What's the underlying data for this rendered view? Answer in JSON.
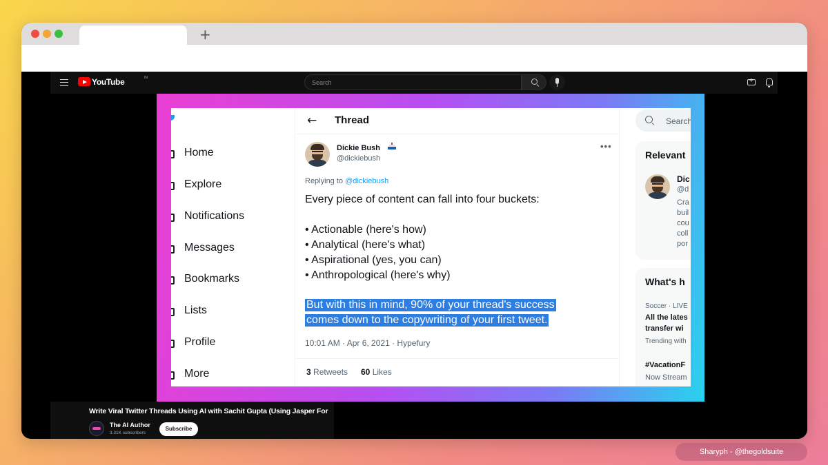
{
  "browser": {
    "new_tab": "+"
  },
  "youtube": {
    "brand": "YouTube",
    "country": "IN",
    "search_placeholder": "Search"
  },
  "twitter": {
    "nav": [
      "Home",
      "Explore",
      "Notifications",
      "Messages",
      "Bookmarks",
      "Lists",
      "Profile",
      "More"
    ],
    "header_title": "Thread",
    "author": {
      "name": "Dickie Bush",
      "handle": "@dickiebush"
    },
    "replying_to_prefix": "Replying to ",
    "replying_to_handle": "@dickiebush",
    "tweet_lines": [
      "Every piece of content can fall into four buckets:",
      "• Actionable (here's how)",
      "• Analytical (here's what)",
      "• Aspirational (yes, you can)",
      "• Anthropological (here's why)"
    ],
    "highlight_lines": [
      "But with this in mind, 90% of your thread's success",
      "comes down to the copywriting of your first tweet."
    ],
    "meta": "10:01 AM · Apr 6, 2021 · Hypefury",
    "retweets_count": "3",
    "retweets_label": " Retweets",
    "likes_count": "60",
    "likes_label": " Likes",
    "more_dots": "•••",
    "right": {
      "search_placeholder": "Search",
      "relevant_title": "Relevant",
      "relevant_name": "Dic",
      "relevant_handle": "@d",
      "relevant_bio": [
        "Cra",
        "buil",
        "cou",
        "coll",
        "por"
      ],
      "whats_title": "What's h",
      "trend1_cat": "Soccer · LIVE",
      "trend1_title": [
        "All the lates",
        "transfer wi"
      ],
      "trend1_sub": "Trending with",
      "trend2_title": "#VacationF",
      "trend2_sub": "Now Stream"
    }
  },
  "video": {
    "title": "Write Viral Twitter Threads Using AI with Sachit Gupta (Using Jasper For",
    "channel": "The AI Author",
    "subscribers": "3.31K subscribers",
    "subscribe_label": "Subscribe"
  },
  "credit": "Sharyph - @thegoldsuite",
  "colors": {
    "youtube_red": "#ff0000",
    "twitter_blue": "#1d9bf0",
    "highlight": "#2c7ee2"
  }
}
